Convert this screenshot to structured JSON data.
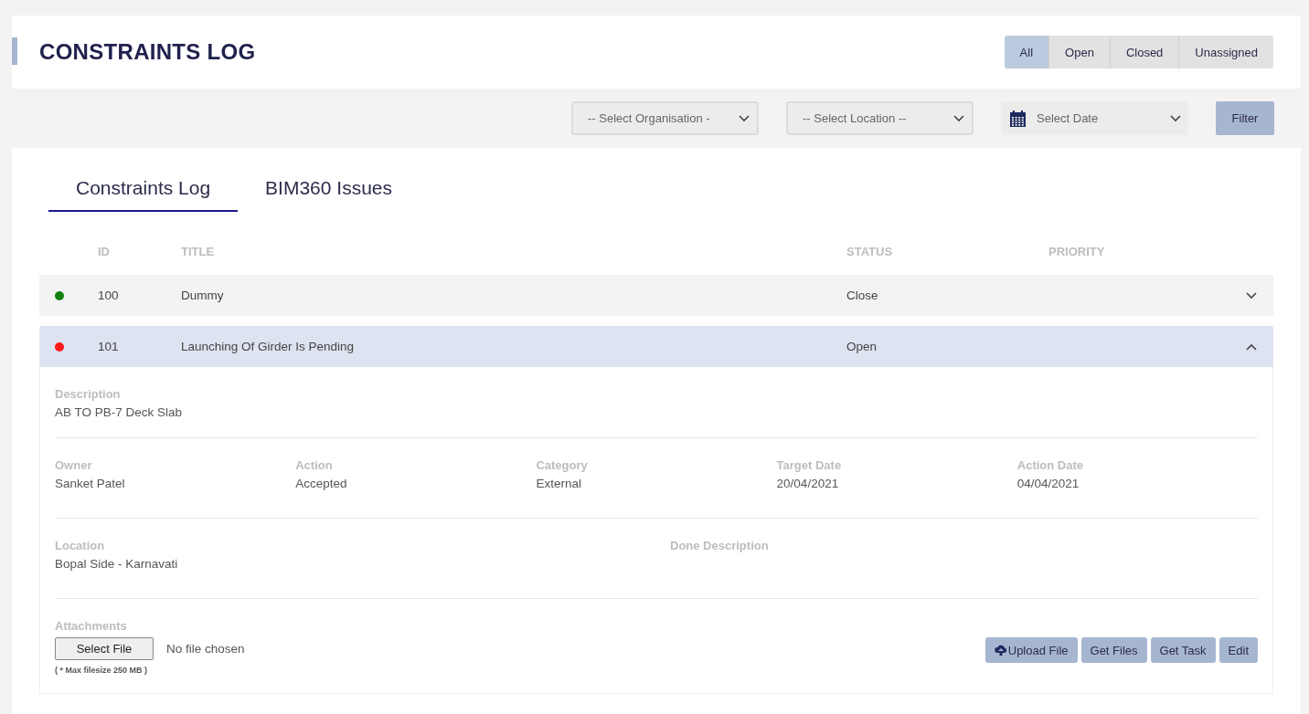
{
  "title": "CONSTRAINTS LOG",
  "segments": [
    {
      "label": "All",
      "selected": true
    },
    {
      "label": "Open",
      "selected": false
    },
    {
      "label": "Closed",
      "selected": false
    },
    {
      "label": "Unassigned",
      "selected": false
    }
  ],
  "filters": {
    "organisation": "-- Select Organisation -",
    "location": "-- Select Location --",
    "date": "Select Date",
    "button": "Filter"
  },
  "tabs": [
    {
      "label": "Constraints Log",
      "selected": true
    },
    {
      "label": "BIM360 Issues",
      "selected": false
    }
  ],
  "columns": [
    "ID",
    "TITLE",
    "STATUS",
    "PRIORITY"
  ],
  "rows": [
    {
      "color": "#108010",
      "id": "100",
      "title": "Dummy",
      "status": "Close",
      "expanded": false
    },
    {
      "color": "#ff1a1a",
      "id": "101",
      "title": "Launching Of Girder Is Pending",
      "status": "Open",
      "expanded": true,
      "details": {
        "description": {
          "label": "Description",
          "value": "AB TO PB-7 Deck Slab"
        },
        "fields": [
          {
            "label": "Owner",
            "value": "Sanket Patel"
          },
          {
            "label": "Action",
            "value": "Accepted"
          },
          {
            "label": "Category",
            "value": "External"
          },
          {
            "label": "Target Date",
            "value": "20/04/2021"
          },
          {
            "label": "Action Date",
            "value": "04/04/2021"
          }
        ],
        "location": {
          "label": "Location",
          "value": "Bopal Side - Karnavati"
        },
        "done_description": {
          "label": "Done Description"
        },
        "attachments": {
          "label": "Attachments",
          "button": "Select File",
          "file": "No file chosen",
          "note": "( * Max filesize 250 MB )"
        },
        "actions": [
          "Upload File",
          "Get Files",
          "Get Task",
          "Edit"
        ]
      }
    }
  ]
}
